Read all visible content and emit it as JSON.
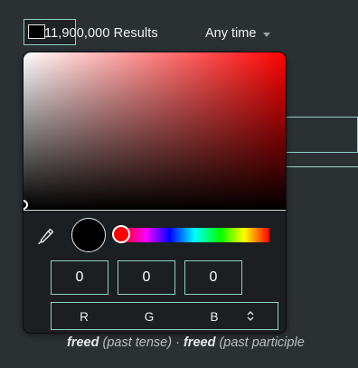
{
  "header": {
    "results_count": "11,900,000 Results",
    "time_filter": "Any time",
    "swatch_color": "#000000"
  },
  "picker": {
    "hue_color": "#ff0000",
    "selected_color": "#000000",
    "channels": {
      "r": "0",
      "g": "0",
      "b": "0"
    },
    "mode_labels": [
      "R",
      "G",
      "B"
    ]
  },
  "snippet": {
    "word1": "freed",
    "note1": " (past tense) ",
    "separator": "·",
    "word2": "freed",
    "note2": " (past participle"
  }
}
